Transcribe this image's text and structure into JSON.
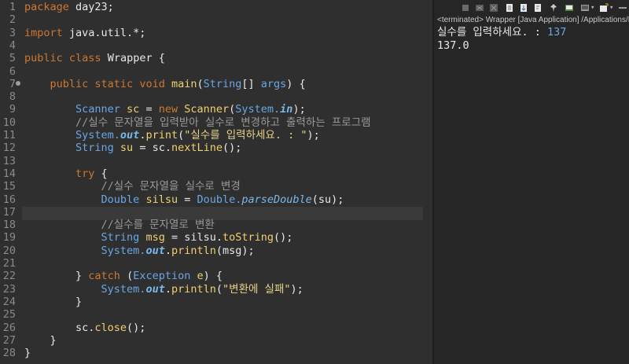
{
  "editor": {
    "line_numbers": [
      "1",
      "2",
      "3",
      "4",
      "5",
      "6",
      "7",
      "8",
      "9",
      "10",
      "11",
      "12",
      "13",
      "14",
      "15",
      "16",
      "17",
      "18",
      "19",
      "20",
      "21",
      "22",
      "23",
      "24",
      "25",
      "26",
      "27",
      "28"
    ],
    "lines": [
      [
        {
          "t": "package ",
          "c": "kw"
        },
        {
          "t": "day23;",
          "c": "plain"
        }
      ],
      [],
      [
        {
          "t": "import ",
          "c": "kw"
        },
        {
          "t": "java.util.*;",
          "c": "plain"
        }
      ],
      [],
      [
        {
          "t": "public ",
          "c": "kw"
        },
        {
          "t": "class ",
          "c": "kw"
        },
        {
          "t": "Wrapper {",
          "c": "plain"
        }
      ],
      [],
      [
        {
          "t": "    public ",
          "c": "kw"
        },
        {
          "t": "static ",
          "c": "kw"
        },
        {
          "t": "void ",
          "c": "kw"
        },
        {
          "t": "main",
          "c": "fn"
        },
        {
          "t": "(",
          "c": "plain"
        },
        {
          "t": "String",
          "c": "typ"
        },
        {
          "t": "[] ",
          "c": "plain"
        },
        {
          "t": "args",
          "c": "typ"
        },
        {
          "t": ") {",
          "c": "plain"
        }
      ],
      [],
      [
        {
          "t": "        Scanner ",
          "c": "typ"
        },
        {
          "t": "sc",
          "c": "fn"
        },
        {
          "t": " = ",
          "c": "plain"
        },
        {
          "t": "new ",
          "c": "kw"
        },
        {
          "t": "Scanner",
          "c": "fn"
        },
        {
          "t": "(",
          "c": "plain"
        },
        {
          "t": "System.",
          "c": "typ"
        },
        {
          "t": "in",
          "c": "fld"
        },
        {
          "t": ");",
          "c": "plain"
        }
      ],
      [
        {
          "t": "        //실수 문자열을 입력받아 실수로 변경하고 출력하는 프로그램",
          "c": "cmt"
        }
      ],
      [
        {
          "t": "        System.",
          "c": "typ"
        },
        {
          "t": "out",
          "c": "fld"
        },
        {
          "t": ".",
          "c": "plain"
        },
        {
          "t": "print",
          "c": "fn"
        },
        {
          "t": "(",
          "c": "plain"
        },
        {
          "t": "\"실수를 입력하세요. : \"",
          "c": "str"
        },
        {
          "t": ");",
          "c": "plain"
        }
      ],
      [
        {
          "t": "        String ",
          "c": "typ"
        },
        {
          "t": "su",
          "c": "fn"
        },
        {
          "t": " = sc.",
          "c": "plain"
        },
        {
          "t": "nextLine",
          "c": "fn"
        },
        {
          "t": "();",
          "c": "plain"
        }
      ],
      [],
      [
        {
          "t": "        try ",
          "c": "kw"
        },
        {
          "t": "{",
          "c": "plain"
        }
      ],
      [
        {
          "t": "            //실수 문자열을 실수로 변경",
          "c": "cmt"
        }
      ],
      [
        {
          "t": "            Double ",
          "c": "typ"
        },
        {
          "t": "silsu",
          "c": "fn"
        },
        {
          "t": " = ",
          "c": "plain"
        },
        {
          "t": "Double.",
          "c": "typ"
        },
        {
          "t": "parseDouble",
          "c": "ital"
        },
        {
          "t": "(su);",
          "c": "plain"
        }
      ],
      [],
      [
        {
          "t": "            //실수를 문자열로 변환",
          "c": "cmt"
        }
      ],
      [
        {
          "t": "            String ",
          "c": "typ"
        },
        {
          "t": "msg",
          "c": "fn"
        },
        {
          "t": " = silsu.",
          "c": "plain"
        },
        {
          "t": "toString",
          "c": "fn"
        },
        {
          "t": "();",
          "c": "plain"
        }
      ],
      [
        {
          "t": "            System.",
          "c": "typ"
        },
        {
          "t": "out",
          "c": "fld"
        },
        {
          "t": ".",
          "c": "plain"
        },
        {
          "t": "println",
          "c": "fn"
        },
        {
          "t": "(msg);",
          "c": "plain"
        }
      ],
      [],
      [
        {
          "t": "        } ",
          "c": "plain"
        },
        {
          "t": "catch ",
          "c": "kw"
        },
        {
          "t": "(",
          "c": "plain"
        },
        {
          "t": "Exception ",
          "c": "typ"
        },
        {
          "t": "e",
          "c": "fn"
        },
        {
          "t": ") {",
          "c": "plain"
        }
      ],
      [
        {
          "t": "            System.",
          "c": "typ"
        },
        {
          "t": "out",
          "c": "fld"
        },
        {
          "t": ".",
          "c": "plain"
        },
        {
          "t": "println",
          "c": "fn"
        },
        {
          "t": "(",
          "c": "plain"
        },
        {
          "t": "\"변환에 실패\"",
          "c": "str"
        },
        {
          "t": ");",
          "c": "plain"
        }
      ],
      [
        {
          "t": "        }",
          "c": "plain"
        }
      ],
      [],
      [
        {
          "t": "        sc.",
          "c": "plain"
        },
        {
          "t": "close",
          "c": "fn"
        },
        {
          "t": "();",
          "c": "plain"
        }
      ],
      [
        {
          "t": "    }",
          "c": "plain"
        }
      ],
      [
        {
          "t": "}",
          "c": "plain"
        }
      ]
    ]
  },
  "console": {
    "title": "<terminated> Wrapper [Java Application] /Applications/E",
    "prompt": "실수를 입력하세요. : ",
    "input": "137",
    "output": "137.0",
    "toolbar_icons": [
      "stop-icon",
      "remove-launch-icon",
      "remove-all-icon",
      "clear-console-icon",
      "scroll-lock-icon",
      "word-wrap-icon",
      "pin-console-icon",
      "display-console-icon",
      "new-console-icon"
    ]
  }
}
